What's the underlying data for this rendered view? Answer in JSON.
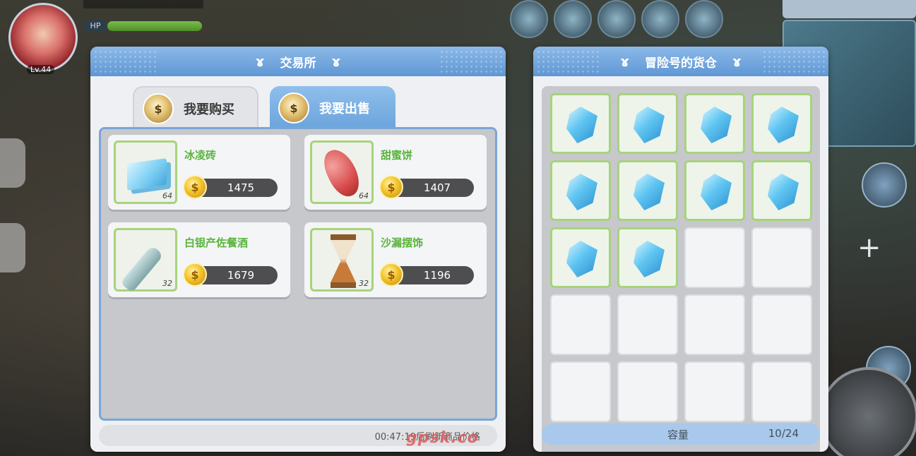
{
  "hud": {
    "level": "Lv.44",
    "hp_label": "HP"
  },
  "market": {
    "title": "交易所",
    "tabs": [
      {
        "label": "我要购买",
        "active": false
      },
      {
        "label": "我要出售",
        "active": true
      }
    ],
    "listings": [
      {
        "name": "冰凌砖",
        "price": "1475",
        "qty": "64"
      },
      {
        "name": "甜蜜饼",
        "price": "1407",
        "qty": "64"
      },
      {
        "name": "白银产佐餐酒",
        "price": "1679",
        "qty": "32"
      },
      {
        "name": "沙漏摆饰",
        "price": "1196",
        "qty": "32"
      }
    ],
    "refresh_timer_text": "00:47:19后刷新商品价格"
  },
  "cargo": {
    "title": "冒险号的货仓",
    "slots_filled": 10,
    "slots_total": 24,
    "capacity_label": "容量",
    "capacity_value": "10/24"
  },
  "watermark": "gpsk.co",
  "colors": {
    "header_blue": "#6aa3dc",
    "item_name_green": "#58b43a",
    "slot_border_green": "#a7d37b",
    "price_pill": "#4e4e50"
  }
}
